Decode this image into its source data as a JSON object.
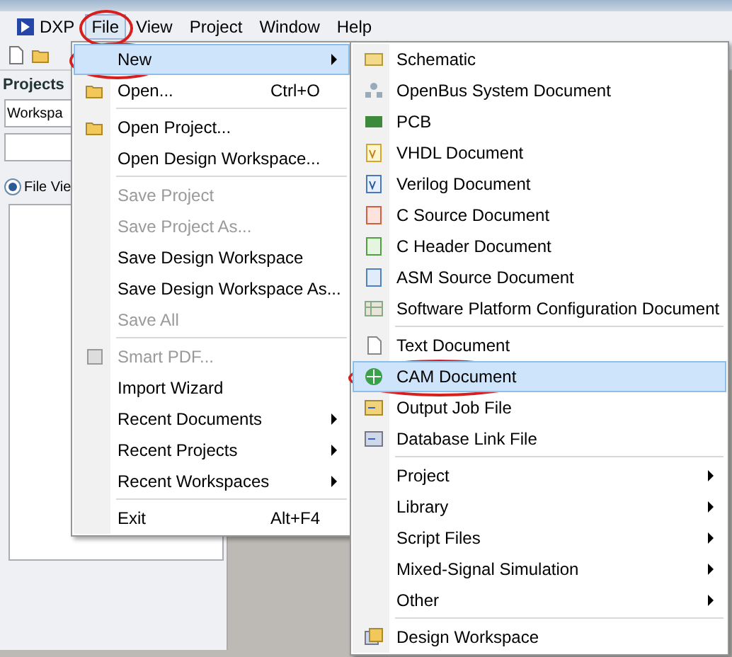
{
  "menu_bar": [
    {
      "label": "DXP",
      "selected": false,
      "circled": false
    },
    {
      "label": "File",
      "selected": true,
      "circled": true
    },
    {
      "label": "View",
      "selected": false,
      "circled": false
    },
    {
      "label": "Project",
      "selected": false,
      "circled": false
    },
    {
      "label": "Window",
      "selected": false,
      "circled": false
    },
    {
      "label": "Help",
      "selected": false,
      "circled": false
    }
  ],
  "projects_panel": {
    "title": "Projects",
    "workspace_field": {
      "value": "Workspa"
    },
    "view_option": {
      "label": "File Vie",
      "selected": true
    }
  },
  "file_menu": [
    {
      "kind": "item",
      "label": "New",
      "submenu": true,
      "disabled": false,
      "selected": true,
      "circled": true
    },
    {
      "kind": "item",
      "label": "Open...",
      "shortcut": "Ctrl+O",
      "disabled": false,
      "selected": false,
      "circled": false
    },
    {
      "kind": "separator"
    },
    {
      "kind": "item",
      "label": "Open Project...",
      "disabled": false,
      "selected": false,
      "circled": false
    },
    {
      "kind": "item",
      "label": "Open Design Workspace...",
      "disabled": false,
      "selected": false,
      "circled": false
    },
    {
      "kind": "separator"
    },
    {
      "kind": "item",
      "label": "Save Project",
      "disabled": true,
      "selected": false,
      "circled": false
    },
    {
      "kind": "item",
      "label": "Save Project As...",
      "disabled": true,
      "selected": false,
      "circled": false
    },
    {
      "kind": "item",
      "label": "Save Design Workspace",
      "disabled": false,
      "selected": false,
      "circled": false
    },
    {
      "kind": "item",
      "label": "Save Design Workspace As...",
      "disabled": false,
      "selected": false,
      "circled": false
    },
    {
      "kind": "item",
      "label": "Save All",
      "disabled": true,
      "selected": false,
      "circled": false
    },
    {
      "kind": "separator"
    },
    {
      "kind": "item",
      "label": "Smart PDF...",
      "disabled": true,
      "selected": false,
      "circled": false
    },
    {
      "kind": "item",
      "label": "Import Wizard",
      "disabled": false,
      "selected": false,
      "circled": false
    },
    {
      "kind": "item",
      "label": "Recent Documents",
      "submenu": true,
      "disabled": false,
      "selected": false,
      "circled": false
    },
    {
      "kind": "item",
      "label": "Recent Projects",
      "submenu": true,
      "disabled": false,
      "selected": false,
      "circled": false
    },
    {
      "kind": "item",
      "label": "Recent Workspaces",
      "submenu": true,
      "disabled": false,
      "selected": false,
      "circled": false
    },
    {
      "kind": "separator"
    },
    {
      "kind": "item",
      "label": "Exit",
      "shortcut": "Alt+F4",
      "disabled": false,
      "selected": false,
      "circled": false
    }
  ],
  "new_submenu": [
    {
      "kind": "item",
      "label": "Schematic",
      "selected": false,
      "circled": false
    },
    {
      "kind": "item",
      "label": "OpenBus System Document",
      "selected": false,
      "circled": false
    },
    {
      "kind": "item",
      "label": "PCB",
      "selected": false,
      "circled": false
    },
    {
      "kind": "item",
      "label": "VHDL Document",
      "selected": false,
      "circled": false
    },
    {
      "kind": "item",
      "label": "Verilog Document",
      "selected": false,
      "circled": false
    },
    {
      "kind": "item",
      "label": "C Source Document",
      "selected": false,
      "circled": false
    },
    {
      "kind": "item",
      "label": "C Header Document",
      "selected": false,
      "circled": false
    },
    {
      "kind": "item",
      "label": "ASM Source Document",
      "selected": false,
      "circled": false
    },
    {
      "kind": "item",
      "label": "Software Platform Configuration Document",
      "selected": false,
      "circled": false
    },
    {
      "kind": "separator"
    },
    {
      "kind": "item",
      "label": "Text Document",
      "selected": false,
      "circled": false
    },
    {
      "kind": "item",
      "label": "CAM Document",
      "selected": true,
      "circled": true
    },
    {
      "kind": "item",
      "label": "Output Job File",
      "selected": false,
      "circled": false
    },
    {
      "kind": "item",
      "label": "Database Link File",
      "selected": false,
      "circled": false
    },
    {
      "kind": "separator"
    },
    {
      "kind": "item",
      "label": "Project",
      "submenu": true,
      "selected": false,
      "circled": false
    },
    {
      "kind": "item",
      "label": "Library",
      "submenu": true,
      "selected": false,
      "circled": false
    },
    {
      "kind": "item",
      "label": "Script Files",
      "submenu": true,
      "selected": false,
      "circled": false
    },
    {
      "kind": "item",
      "label": "Mixed-Signal Simulation",
      "submenu": true,
      "selected": false,
      "circled": false
    },
    {
      "kind": "item",
      "label": "Other",
      "submenu": true,
      "selected": false,
      "circled": false
    },
    {
      "kind": "separator"
    },
    {
      "kind": "item",
      "label": "Design Workspace",
      "selected": false,
      "circled": false
    }
  ]
}
